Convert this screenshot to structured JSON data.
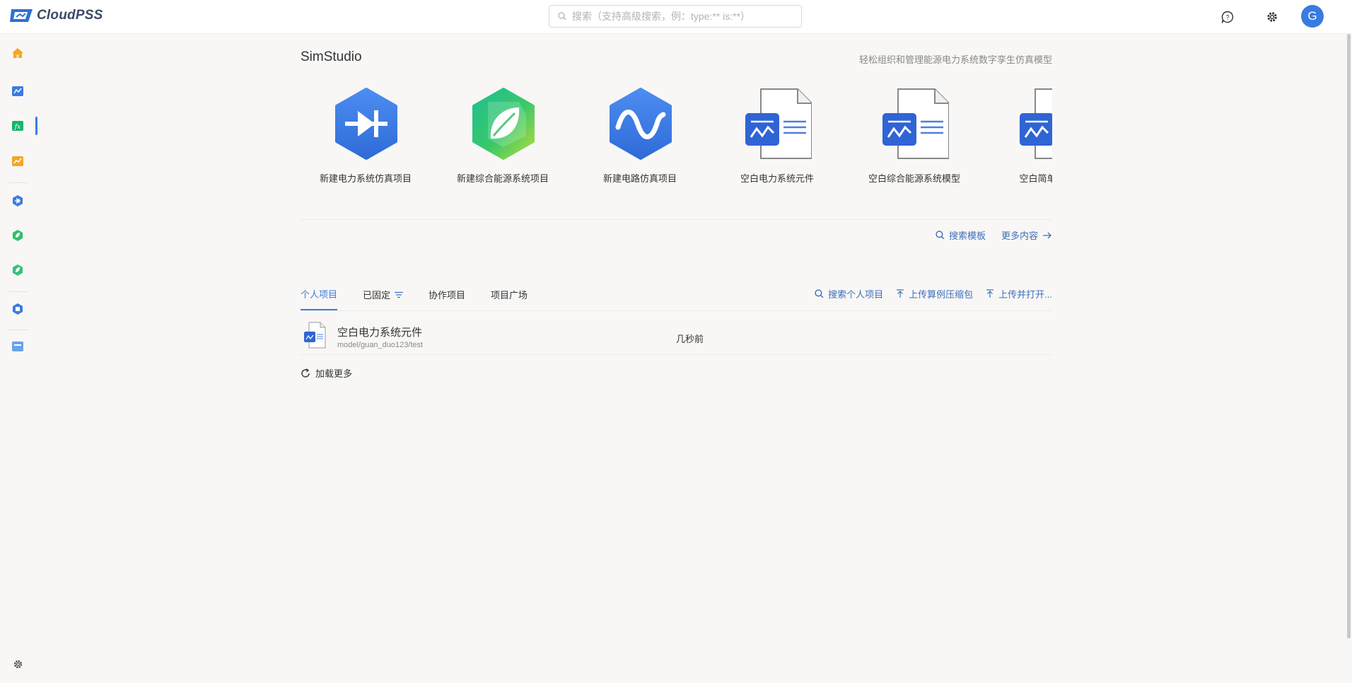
{
  "topbar": {
    "logo_text": "CloudPSS",
    "search_placeholder": "搜索（支持高级搜索，例：type:** is:**）",
    "avatar_letter": "G"
  },
  "sidebar": {
    "items": [
      {
        "icon": "home-icon",
        "color": "#f5a623"
      },
      {
        "icon": "simstudio-icon",
        "color": "#3a7be0",
        "active": true
      },
      {
        "icon": "function-icon",
        "color": "#19b46b"
      },
      {
        "icon": "chart-icon",
        "color": "#f5a623"
      },
      {
        "icon": "diode-hex-icon",
        "color": "#3a7be0"
      },
      {
        "icon": "leaf-hex-icon",
        "color": "#2fc06b"
      },
      {
        "icon": "leaf-hex-icon",
        "color": "#2fc06b"
      },
      {
        "icon": "document-hex-icon",
        "color": "#3a7be0"
      },
      {
        "icon": "folder-icon",
        "color": "#6aa3e6"
      }
    ],
    "bottom_icon": "gear-icon"
  },
  "header": {
    "title": "SimStudio",
    "subtitle": "轻松组织和管理能源电力系统数字孪生仿真模型"
  },
  "templates": [
    {
      "label": "新建电力系统仿真项目",
      "icon": "diode-hex-icon"
    },
    {
      "label": "新建综合能源系统项目",
      "icon": "leaf-hex-icon"
    },
    {
      "label": "新建电路仿真项目",
      "icon": "wave-hex-icon"
    },
    {
      "label": "空白电力系统元件",
      "icon": "document-icon"
    },
    {
      "label": "空白综合能源系统模型",
      "icon": "document-icon"
    },
    {
      "label": "空白简单电元件",
      "icon": "document-icon"
    }
  ],
  "template_links": {
    "search": "搜索模板",
    "more": "更多内容"
  },
  "tabs": [
    {
      "label": "个人项目",
      "active": true
    },
    {
      "label": "已固定"
    },
    {
      "label": "协作项目"
    },
    {
      "label": "项目广场"
    }
  ],
  "tab_actions": {
    "search": "搜索个人项目",
    "upload_zip": "上传算例压缩包",
    "upload_open": "上传并打开..."
  },
  "projects": [
    {
      "name": "空白电力系统元件",
      "path": "model/guan_duo123/test",
      "time": "几秒前"
    }
  ],
  "load_more": "加载更多",
  "colors": {
    "accent": "#3a7be0",
    "link": "#3d6fb8",
    "background": "#f8f7f6"
  }
}
